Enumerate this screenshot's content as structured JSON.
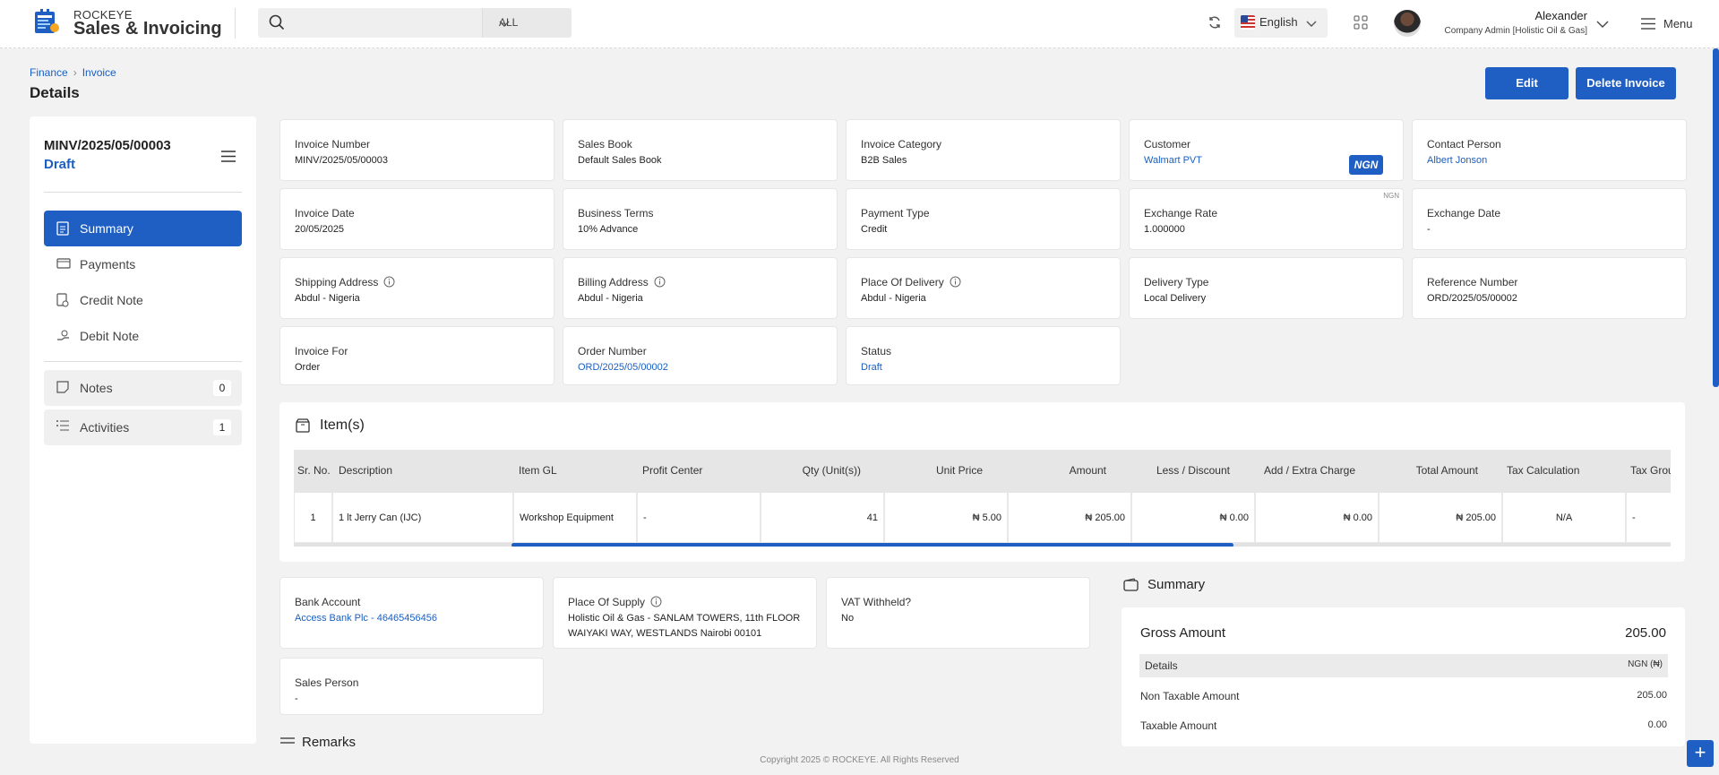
{
  "header": {
    "brand_top": "ROCKEYE",
    "brand_main": "Sales & Invoicing",
    "search_placeholder": "",
    "scope": "ALL",
    "language": "English",
    "user_name": "Alexander",
    "user_role": "Company Admin [Holistic Oil & Gas]",
    "menu_label": "Menu"
  },
  "breadcrumb": {
    "finance": "Finance",
    "invoice": "Invoice"
  },
  "page_title": "Details",
  "actions": {
    "edit": "Edit",
    "delete": "Delete Invoice"
  },
  "sidebar": {
    "doc_no": "MINV/2025/05/00003",
    "status": "Draft",
    "nav": [
      {
        "label": "Summary",
        "icon": "document-icon"
      },
      {
        "label": "Payments",
        "icon": "card-icon"
      },
      {
        "label": "Credit Note",
        "icon": "credit-note-icon"
      },
      {
        "label": "Debit Note",
        "icon": "debit-note-icon"
      }
    ],
    "notes": {
      "label": "Notes",
      "count": "0"
    },
    "activities": {
      "label": "Activities",
      "count": "1"
    }
  },
  "fields": {
    "invoice_number": {
      "label": "Invoice Number",
      "value": "MINV/2025/05/00003"
    },
    "sales_book": {
      "label": "Sales Book",
      "value": "Default Sales Book"
    },
    "invoice_category": {
      "label": "Invoice Category",
      "value": "B2B Sales"
    },
    "customer": {
      "label": "Customer",
      "value": "Walmart PVT",
      "currency_badge": "NGN",
      "currency_tag": "NGN"
    },
    "contact_person": {
      "label": "Contact Person",
      "value": "Albert Jonson"
    },
    "invoice_date": {
      "label": "Invoice Date",
      "value": "20/05/2025"
    },
    "business_terms": {
      "label": "Business Terms",
      "value": "10% Advance"
    },
    "payment_type": {
      "label": "Payment Type",
      "value": "Credit"
    },
    "exchange_rate": {
      "label": "Exchange Rate",
      "value": "1.000000"
    },
    "exchange_date": {
      "label": "Exchange Date",
      "value": "-"
    },
    "shipping_address": {
      "label": "Shipping Address",
      "value": "Abdul - Nigeria"
    },
    "billing_address": {
      "label": "Billing Address",
      "value": "Abdul - Nigeria"
    },
    "place_of_delivery": {
      "label": "Place Of Delivery",
      "value": "Abdul - Nigeria"
    },
    "delivery_type": {
      "label": "Delivery Type",
      "value": "Local Delivery"
    },
    "reference_number": {
      "label": "Reference Number",
      "value": "ORD/2025/05/00002"
    },
    "invoice_for": {
      "label": "Invoice For",
      "value": "Order"
    },
    "order_number": {
      "label": "Order Number",
      "value": "ORD/2025/05/00002"
    },
    "status": {
      "label": "Status",
      "value": "Draft"
    }
  },
  "items": {
    "title": "Item(s)",
    "columns": [
      "Sr. No.",
      "Description",
      "Item GL",
      "Profit Center",
      "Qty (Unit(s))",
      "Unit Price",
      "Amount",
      "Less / Discount",
      "Add / Extra Charge",
      "Total Amount",
      "Tax Calculation",
      "Tax Grou"
    ],
    "rows": [
      {
        "sr": "1",
        "description": "1 lt Jerry Can (IJC)",
        "item_gl": "Workshop Equipment",
        "profit_center": "-",
        "qty": "41",
        "unit_price": "₦ 5.00",
        "amount": "₦ 205.00",
        "discount": "₦ 0.00",
        "extra": "₦ 0.00",
        "total": "₦ 205.00",
        "tax_calc": "N/A",
        "tax_group": "-"
      }
    ]
  },
  "bottom_fields": {
    "bank_account": {
      "label": "Bank Account",
      "value": "Access Bank Plc - 46465456456"
    },
    "place_of_supply": {
      "label": "Place Of Supply",
      "value_line1": "Holistic Oil & Gas - SANLAM TOWERS, 11th FLOOR",
      "value_line2": "WAIYAKI WAY, WESTLANDS Nairobi 00101"
    },
    "vat_withheld": {
      "label": "VAT Withheld?",
      "value": "No"
    },
    "sales_person": {
      "label": "Sales Person",
      "value": "-"
    }
  },
  "summary": {
    "title": "Summary",
    "gross_label": "Gross Amount",
    "gross_value": "205.00",
    "details_label": "Details",
    "details_currency": "NGN (₦)",
    "non_taxable_label": "Non Taxable Amount",
    "non_taxable_value": "205.00",
    "taxable_label": "Taxable Amount",
    "taxable_value": "0.00"
  },
  "remarks_label": "Remarks",
  "footer": "Copyright 2025 © ROCKEYE. All Rights Reserved",
  "colors": {
    "primary": "#1f5fc4",
    "link": "#1a5fc1",
    "background": "#f2f2f2"
  }
}
